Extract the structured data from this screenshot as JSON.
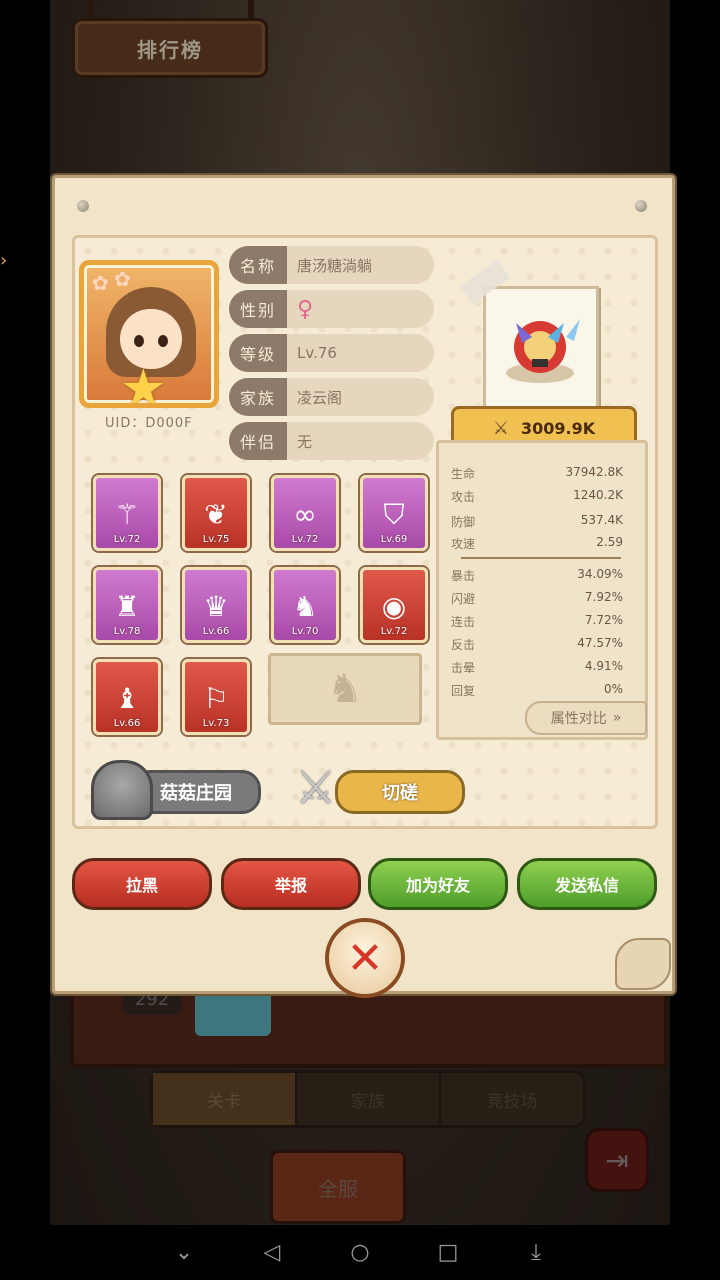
{
  "ranking_title": "排行榜",
  "player": {
    "uid": "UID：D000F",
    "info": [
      {
        "label": "名称",
        "value": "唐汤糖淌躺"
      },
      {
        "label": "性别",
        "value": "♀"
      },
      {
        "label": "等级",
        "value": "Lv.76"
      },
      {
        "label": "家族",
        "value": "凌云阁"
      },
      {
        "label": "伴侣",
        "value": "无"
      }
    ]
  },
  "power": "3009.9K",
  "stats_primary": [
    {
      "k": "生命",
      "v": "37942.8K"
    },
    {
      "k": "攻击",
      "v": "1240.2K"
    },
    {
      "k": "防御",
      "v": "537.4K"
    },
    {
      "k": "攻速",
      "v": "2.59"
    }
  ],
  "stats_secondary": [
    {
      "k": "暴击",
      "v": "34.09%"
    },
    {
      "k": "闪避",
      "v": "7.92%"
    },
    {
      "k": "连击",
      "v": "7.72%"
    },
    {
      "k": "反击",
      "v": "47.57%"
    },
    {
      "k": "击晕",
      "v": "4.91%"
    },
    {
      "k": "回复",
      "v": "0%"
    }
  ],
  "compare_label": "属性对比",
  "equipment": [
    {
      "lv": "Lv.72",
      "rarity": "purple",
      "icon": "staff-icon"
    },
    {
      "lv": "Lv.75",
      "rarity": "red",
      "icon": "wing-icon"
    },
    {
      "lv": "Lv.72",
      "rarity": "purple",
      "icon": "goggles-icon"
    },
    {
      "lv": "Lv.69",
      "rarity": "purple",
      "icon": "helmet-icon"
    },
    {
      "lv": "Lv.78",
      "rarity": "purple",
      "icon": "armor-icon"
    },
    {
      "lv": "Lv.66",
      "rarity": "purple",
      "icon": "crown-icon"
    },
    {
      "lv": "Lv.70",
      "rarity": "purple",
      "icon": "beast-icon"
    },
    {
      "lv": "Lv.72",
      "rarity": "red",
      "icon": "orb-icon"
    },
    {
      "lv": "Lv.66",
      "rarity": "red",
      "icon": "mech-helmet-icon"
    },
    {
      "lv": "Lv.73",
      "rarity": "red",
      "icon": "boots-icon"
    }
  ],
  "buttons": {
    "mushroom": "菇菇庄园",
    "spar": "切磋",
    "block": "拉黑",
    "report": "举报",
    "add_friend": "加为好友",
    "message": "发送私信"
  },
  "background": {
    "score": "292",
    "tabs": [
      "关卡",
      "家族",
      "竞技场"
    ],
    "all_server": "全服"
  }
}
